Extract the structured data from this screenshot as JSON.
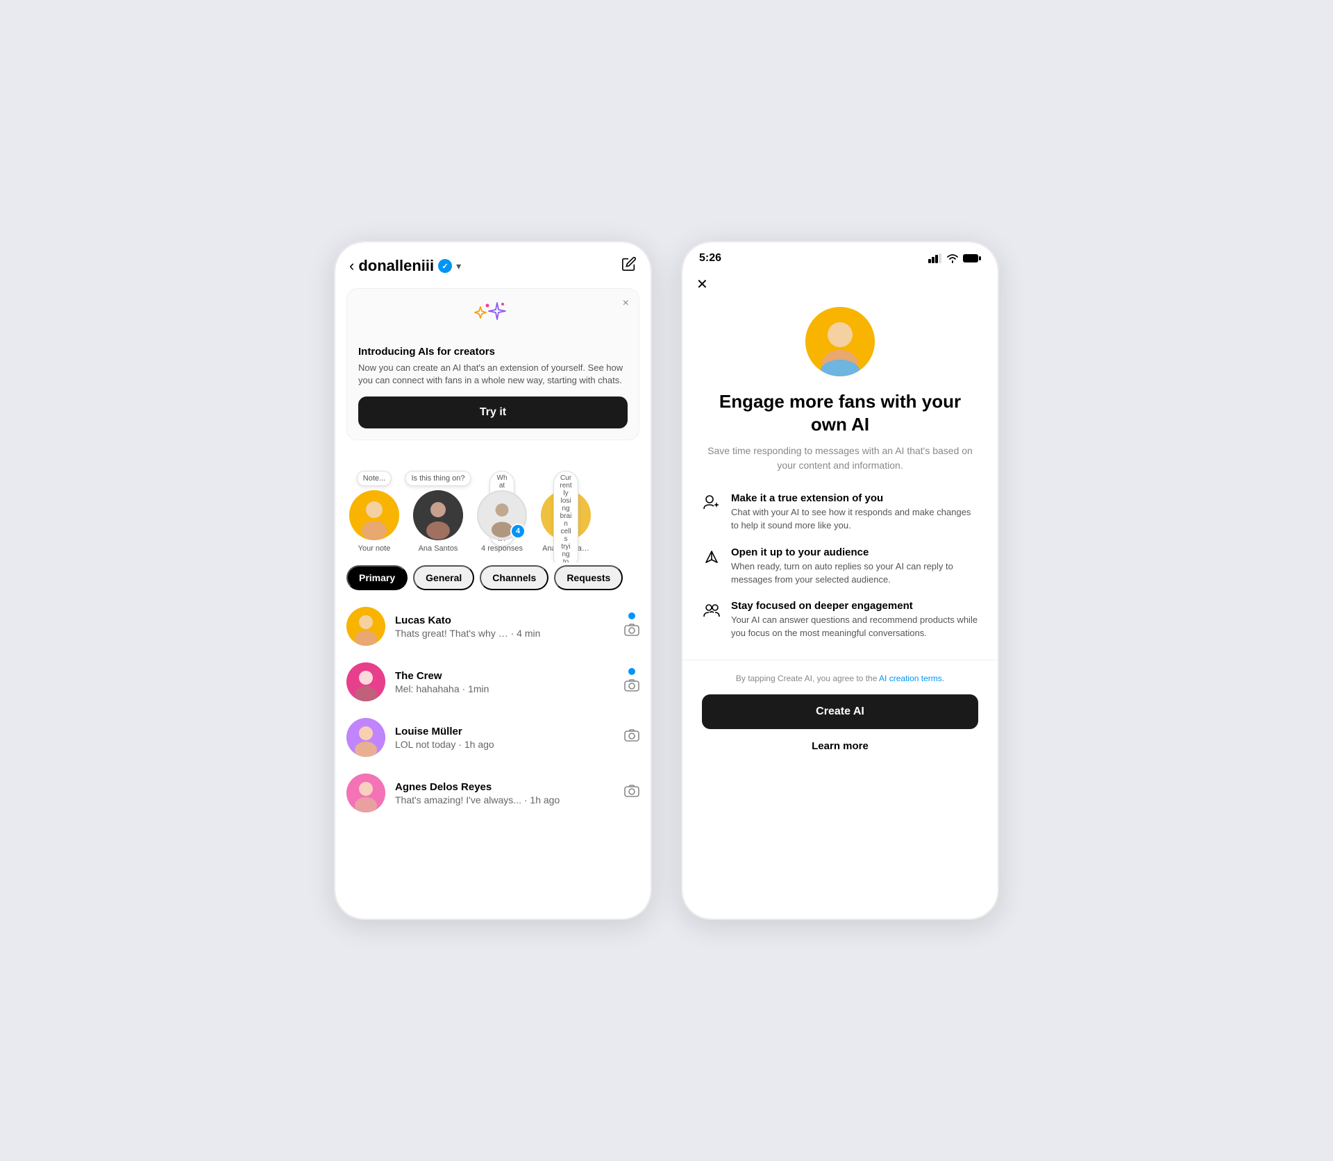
{
  "left": {
    "header": {
      "back_label": "‹",
      "username": "donalleniii",
      "verified": true,
      "chevron": "∨",
      "edit_icon": "✎"
    },
    "ai_banner": {
      "title": "Introducing AIs for creators",
      "description": "Now you can create an AI that's an extension of yourself. See how you can connect with fans in a whole new way, starting with chats.",
      "try_label": "Try it",
      "close": "×"
    },
    "stories": [
      {
        "label": "Your note",
        "note": "Note...",
        "bg": "#f8b400",
        "emoji": "😊"
      },
      {
        "label": "Ana Santos",
        "note": "Is this thing on?",
        "bg": "#2d2d2d",
        "emoji": "👩"
      },
      {
        "label": "4 responses",
        "note": "What are you bringing now?",
        "bg": "#e0e0e0",
        "emoji": "👤",
        "badge": "4"
      },
      {
        "label": "Ana Thomas",
        "note": "Currently losing brain cells trying to",
        "bg": "#f0c040",
        "emoji": "👩‍🦱"
      }
    ],
    "tabs": [
      {
        "label": "Primary",
        "active": true
      },
      {
        "label": "General",
        "active": false
      },
      {
        "label": "Channels",
        "active": false
      },
      {
        "label": "Requests",
        "active": false
      }
    ],
    "messages": [
      {
        "name": "Lucas Kato",
        "preview": "Thats great! That's why … · 4 min",
        "unread": true,
        "bg": "#f8b400"
      },
      {
        "name": "The Crew",
        "preview": "Mel: hahahaha · 1min",
        "unread": true,
        "bg": "#e83f8c"
      },
      {
        "name": "Louise Müller",
        "preview": "LOL not today · 1h ago",
        "unread": false,
        "bg": "#c084fc"
      },
      {
        "name": "Agnes Delos Reyes",
        "preview": "That's amazing! I've always... · 1h ago",
        "unread": false,
        "bg": "#f472b6"
      }
    ]
  },
  "right": {
    "status_bar": {
      "time": "5:26",
      "signal": "▌▌▌",
      "wifi": "wifi",
      "battery": "battery"
    },
    "close_icon": "✕",
    "main_title": "Engage more fans with your own AI",
    "subtitle": "Save time responding to messages with an AI that's based on your content and information.",
    "features": [
      {
        "icon": "person-sparkle",
        "title": "Make it a true extension of you",
        "desc": "Chat with your AI to see how it responds and make changes to help it sound more like you."
      },
      {
        "icon": "triangle-down",
        "title": "Open it up to your audience",
        "desc": "When ready, turn on auto replies so your AI can reply to messages from your selected audience."
      },
      {
        "icon": "people-focus",
        "title": "Stay focused on deeper engagement",
        "desc": "Your AI can answer questions and recommend products while you focus on the most meaningful conversations."
      }
    ],
    "terms_text": "By tapping Create AI, you agree to the",
    "terms_link": "AI creation terms.",
    "create_label": "Create AI",
    "learn_more_label": "Learn more"
  }
}
